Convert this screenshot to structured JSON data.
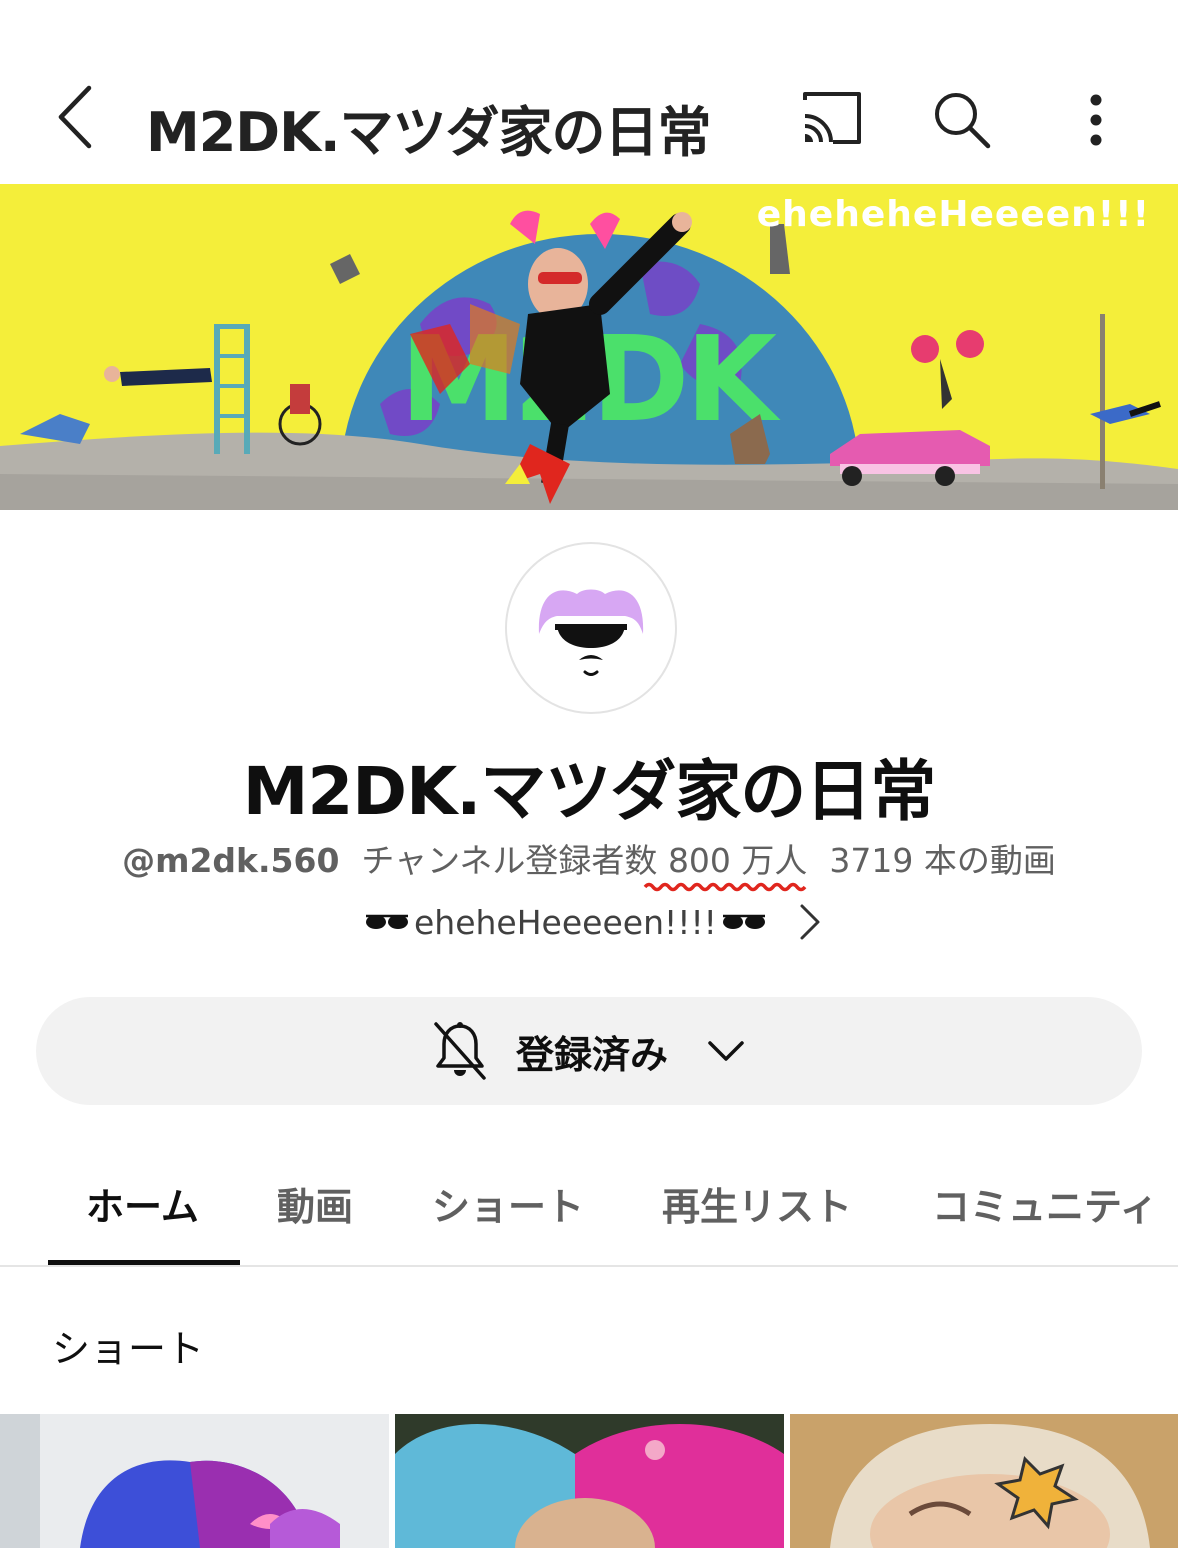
{
  "topbar": {
    "title": "M2DK.マツダ家の日常",
    "icons": [
      "back-chevron-icon",
      "cast-icon",
      "search-icon",
      "more-vert-icon"
    ]
  },
  "banner": {
    "tagline": "eheheheHeeeen!!!",
    "logo_text": "M2DK"
  },
  "channel": {
    "name": "M2DK.マツダ家の日常",
    "handle": "@m2dk.560",
    "subs_label": "チャンネル登録者数",
    "subs_count": "800 万人",
    "videos": "3719 本の動画",
    "description": "eheheHeeeeen!!!!"
  },
  "subscribe": {
    "label": "登録済み",
    "icons": [
      "bell-off-icon",
      "chevron-down-icon"
    ]
  },
  "tabs": [
    {
      "label": "ホーム",
      "active": true
    },
    {
      "label": "動画",
      "active": false
    },
    {
      "label": "ショート",
      "active": false
    },
    {
      "label": "再生リスト",
      "active": false
    },
    {
      "label": "コミュニティ",
      "active": false
    }
  ],
  "section": {
    "title": "ショート"
  },
  "colors": {
    "banner_yellow": "#f4ee3a",
    "logo_green": "#4be06b",
    "globe_blue": "#3f88b8",
    "subscribe_bg": "#f2f2f2",
    "highlight_red": "#e0261e"
  }
}
